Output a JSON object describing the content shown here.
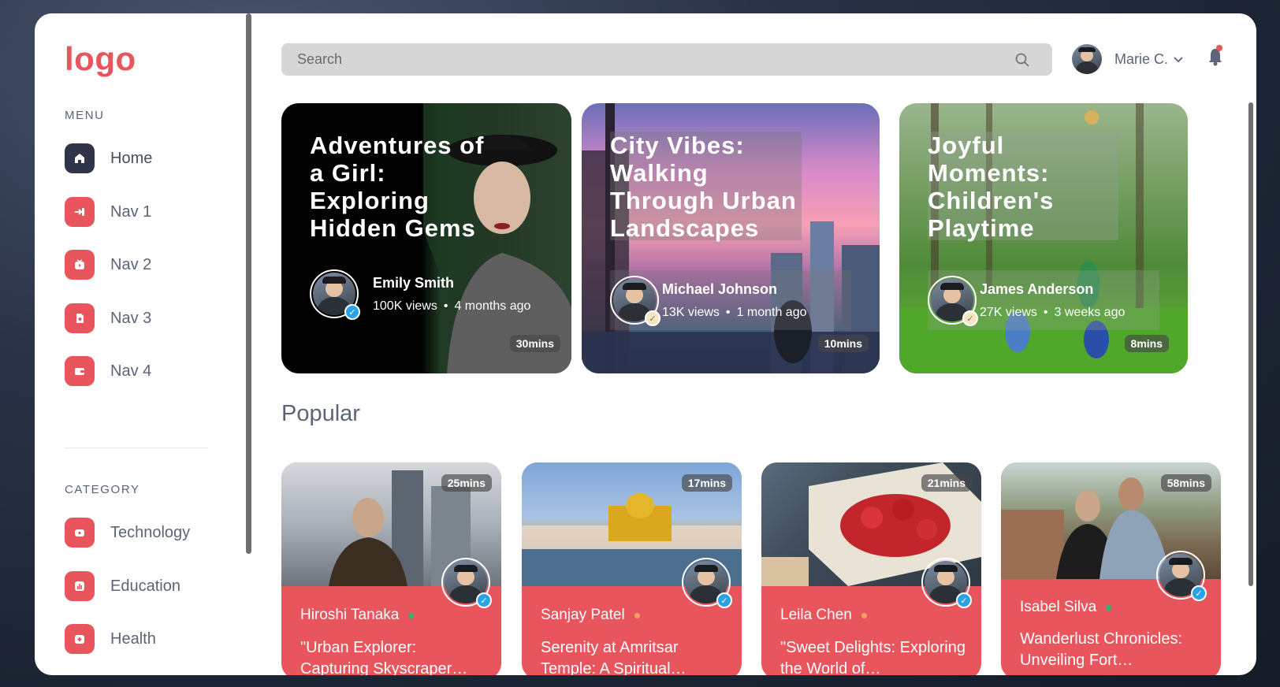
{
  "sidebar": {
    "logo": "logo",
    "menu_title": "MENU",
    "menu_items": [
      {
        "label": "Home",
        "icon": "home-icon"
      },
      {
        "label": "Nav 1",
        "icon": "login-icon"
      },
      {
        "label": "Nav 2",
        "icon": "play-icon"
      },
      {
        "label": "Nav 3",
        "icon": "file-icon"
      },
      {
        "label": "Nav 4",
        "icon": "wallet-icon"
      }
    ],
    "category_title": "CATEGORY",
    "category_items": [
      {
        "label": "Technology",
        "icon": "monitor-icon"
      },
      {
        "label": "Education",
        "icon": "chart-icon"
      },
      {
        "label": "Health",
        "icon": "health-icon"
      }
    ]
  },
  "header": {
    "search_placeholder": "Search",
    "user_name": "Marie C."
  },
  "featured": [
    {
      "title": "Adventures of a Girl: Exploring Hidden Gems",
      "author": "Emily Smith",
      "views": "100K views",
      "age": "4 months ago",
      "duration": "30mins"
    },
    {
      "title": "City Vibes: Walking Through Urban Landscapes",
      "author": "Michael Johnson",
      "views": "13K views",
      "age": "1 month ago",
      "duration": "10mins"
    },
    {
      "title": "Joyful Moments: Children's Playtime",
      "author": "James Anderson",
      "views": "27K views",
      "age": "3 weeks ago",
      "duration": "8mins"
    }
  ],
  "popular": {
    "title": "Popular",
    "items": [
      {
        "author": "Hiroshi Tanaka",
        "status_color": "#2bb673",
        "title": "\"Urban Explorer: Capturing Skyscraper…",
        "duration": "25mins"
      },
      {
        "author": "Sanjay Patel",
        "status_color": "#f7a35c",
        "title": "Serenity at Amritsar Temple: A Spiritual…",
        "duration": "17mins"
      },
      {
        "author": "Leila Chen",
        "status_color": "#f7a35c",
        "title": "\"Sweet Delights: Exploring the World of…",
        "duration": "21mins"
      },
      {
        "author": "Isabel Silva",
        "status_color": "#2bb673",
        "title": "Wanderlust Chronicles: Unveiling Fort…",
        "duration": "58mins"
      }
    ]
  },
  "colors": {
    "accent": "#e8555c",
    "dark": "#2f3448",
    "verified": "#2aa2e8"
  }
}
